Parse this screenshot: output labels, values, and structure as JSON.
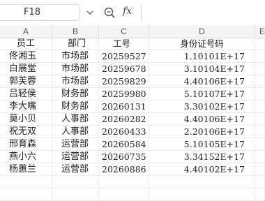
{
  "formula_bar": {
    "cell_ref": "F18",
    "fx_label": "fx",
    "formula": ""
  },
  "columns": [
    "A",
    "B",
    "C",
    "D",
    "E"
  ],
  "header_row": {
    "a": "员工",
    "b": "部门",
    "c": "工号",
    "d": "身份证号码"
  },
  "rows": [
    {
      "a": "佟湘玉",
      "b": "市场部",
      "c": "20259527",
      "d": "1.10101E+17"
    },
    {
      "a": "白展堂",
      "b": "市场部",
      "c": "20259678",
      "d": "3.10104E+17"
    },
    {
      "a": "郭芙蓉",
      "b": "市场部",
      "c": "20259829",
      "d": "4.40106E+17"
    },
    {
      "a": "吕轻侯",
      "b": "财务部",
      "c": "20259980",
      "d": "5.10107E+17"
    },
    {
      "a": "李大嘴",
      "b": "财务部",
      "c": "20260131",
      "d": "3.30102E+17"
    },
    {
      "a": "莫小贝",
      "b": "人事部",
      "c": "20260282",
      "d": "4.40106E+17"
    },
    {
      "a": "祝无双",
      "b": "人事部",
      "c": "20260433",
      "d": "2.20106E+17"
    },
    {
      "a": "邢育森",
      "b": "运营部",
      "c": "20260584",
      "d": "5.10105E+17"
    },
    {
      "a": "燕小六",
      "b": "运营部",
      "c": "20260735",
      "d": "3.34152E+17"
    },
    {
      "a": "杨蕙兰",
      "b": "运营部",
      "c": "20260886",
      "d": "4.40102E+17"
    }
  ],
  "icons": {
    "namebox_dropdown": "chevron-down-icon",
    "zoom_function": "zoom-function-icon"
  }
}
